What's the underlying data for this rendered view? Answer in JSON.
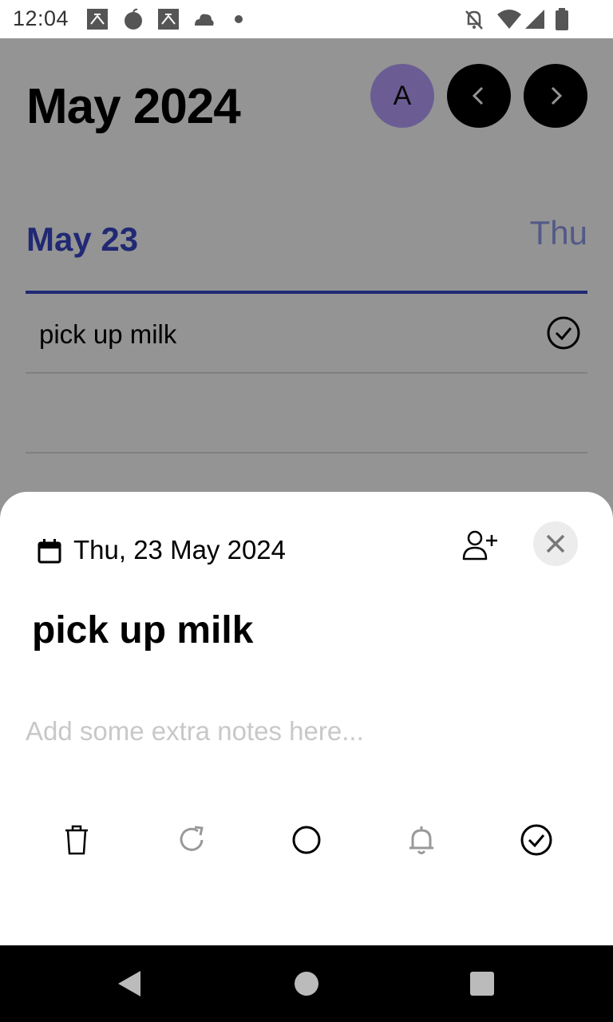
{
  "status_bar": {
    "time": "12:04",
    "icons": [
      "app-icon-1",
      "apple-icon",
      "app-icon-2",
      "cloud-icon",
      "dot-icon",
      "notifications-off-icon",
      "wifi-icon",
      "signal-icon",
      "battery-icon"
    ]
  },
  "header": {
    "title": "May 2024",
    "avatar_initial": "A",
    "prev_icon": "chevron-left-icon",
    "next_icon": "chevron-right-icon"
  },
  "day": {
    "date_label": "May 23",
    "weekday_label": "Thu"
  },
  "tasks": [
    {
      "text": "pick up milk",
      "completed": true
    }
  ],
  "sheet": {
    "date_label": "Thu, 23 May 2024",
    "title": "pick up milk",
    "notes_value": "",
    "notes_placeholder": "Add some extra notes here...",
    "actions": [
      "trash-icon",
      "repeat-icon",
      "circle-icon",
      "bell-icon",
      "check-circle-icon"
    ]
  },
  "colors": {
    "accent": "#3a47c8",
    "accent_light": "#8f9ae8",
    "avatar": "#b9a0ff",
    "scrim": "rgba(0,0,0,0.42)"
  }
}
